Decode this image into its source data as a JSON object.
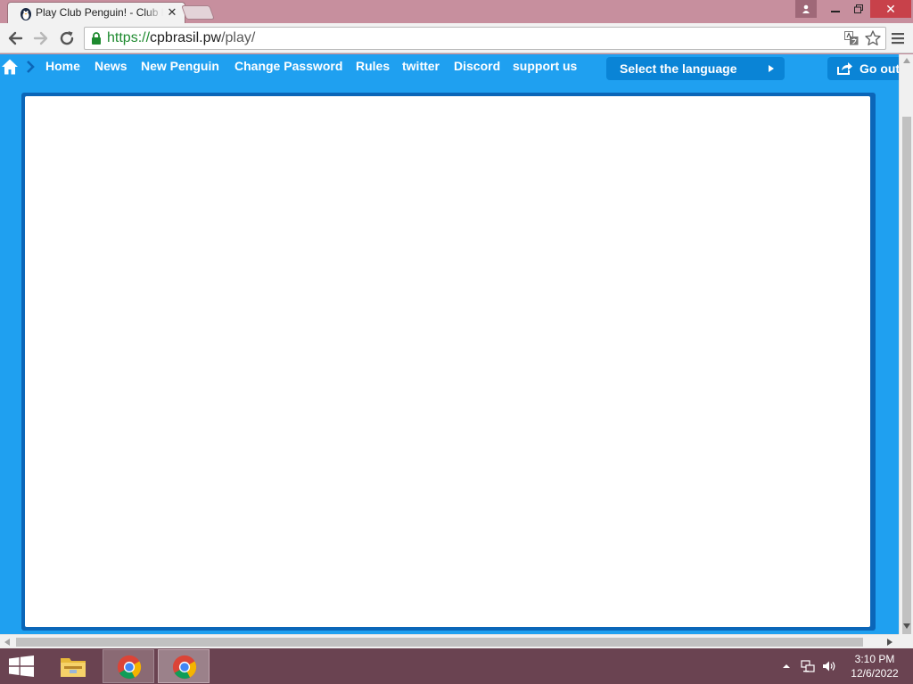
{
  "browser": {
    "tab": {
      "title": "Play Club Penguin! - Club Penguin"
    },
    "address_bar": {
      "url_scheme": "https://",
      "url_host": "cpbrasil.pw",
      "url_path": "/play/"
    }
  },
  "site": {
    "nav": {
      "items": [
        {
          "label": "Home"
        },
        {
          "label": "News"
        },
        {
          "label": "New Penguin"
        },
        {
          "label": "Change Password"
        },
        {
          "label": "Rules"
        },
        {
          "label": "twitter"
        },
        {
          "label": "Discord"
        },
        {
          "label": "support us"
        }
      ],
      "language_label": "Select the language",
      "logout_label": "Go out"
    }
  },
  "taskbar": {
    "clock_time": "3:10 PM",
    "clock_date": "12/6/2022"
  },
  "colors": {
    "page_background": "#1fa0f0",
    "frame_border": "#0b66b8",
    "nav_button": "#0a84d6",
    "titlebar": "#c78f9e",
    "taskbar": "#6a4351"
  }
}
